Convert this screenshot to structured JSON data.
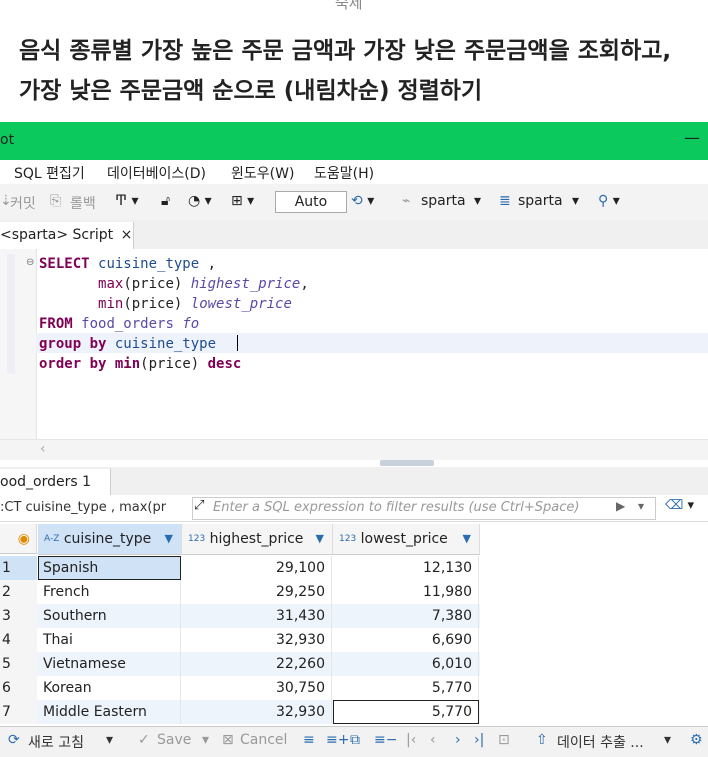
{
  "article": {
    "section_label": "숙제",
    "heading": "음식 종류별 가장 높은 주문 금액과 가장 낮은 주문금액을 조회하고, 가장 낮은 주문금액 순으로 (내림차순) 정렬하기"
  },
  "window": {
    "title_fragment": "ot",
    "minimize": "—",
    "titlebar_color": "#0bc95d"
  },
  "menu": [
    "SQL 편집기",
    "데이터베이스(D)",
    "윈도우(W)",
    "도움말(H)"
  ],
  "toolbar": {
    "commit": "커밋",
    "rollback": "롤백",
    "transaction_mode": "Auto",
    "connection": "sparta",
    "database": "sparta"
  },
  "editor_tab": {
    "label": "<sparta> Script",
    "close": "×"
  },
  "sql": {
    "l1_kw": "SELECT",
    "l1_col": "cuisine_type",
    "l1_comma": " ,",
    "l2_fn": "max",
    "l2_args": "(price)",
    "l2_alias": "highest_price",
    "l2_comma": ",",
    "l3_fn": "min",
    "l3_args": "(price)",
    "l3_alias": "lowest_price",
    "l4_kw": "FROM",
    "l4_table": "food_orders",
    "l4_alias": "fo",
    "l5_kw": "group by",
    "l5_col": "cuisine_type",
    "l6_kw": "order by",
    "l6_fn": "min",
    "l6_args": "(price)",
    "l6_dir": "desc"
  },
  "results_tab": {
    "label": "ood_orders 1",
    "close": "×"
  },
  "filter": {
    "query_preview": ":CT cuisine_type , max(pr",
    "placeholder": "Enter a SQL expression to filter results (use Ctrl+Space)"
  },
  "grid": {
    "columns": [
      {
        "type": "A-Z",
        "name": "cuisine_type"
      },
      {
        "type": "123",
        "name": "highest_price"
      },
      {
        "type": "123",
        "name": "lowest_price"
      }
    ],
    "rows": [
      {
        "n": "1",
        "cuisine_type": "Spanish",
        "highest_price": "29,100",
        "lowest_price": "12,130"
      },
      {
        "n": "2",
        "cuisine_type": "French",
        "highest_price": "29,250",
        "lowest_price": "11,980"
      },
      {
        "n": "3",
        "cuisine_type": "Southern",
        "highest_price": "31,430",
        "lowest_price": "7,380"
      },
      {
        "n": "4",
        "cuisine_type": "Thai",
        "highest_price": "32,930",
        "lowest_price": "6,690"
      },
      {
        "n": "5",
        "cuisine_type": "Vietnamese",
        "highest_price": "22,260",
        "lowest_price": "6,010"
      },
      {
        "n": "6",
        "cuisine_type": "Korean",
        "highest_price": "30,750",
        "lowest_price": "5,770"
      },
      {
        "n": "7",
        "cuisine_type": "Middle Eastern",
        "highest_price": "32,930",
        "lowest_price": "5,770"
      }
    ]
  },
  "bottom": {
    "refresh": "새로 고침",
    "save": "Save",
    "cancel": "Cancel",
    "export": "데이터 추출 ..."
  }
}
